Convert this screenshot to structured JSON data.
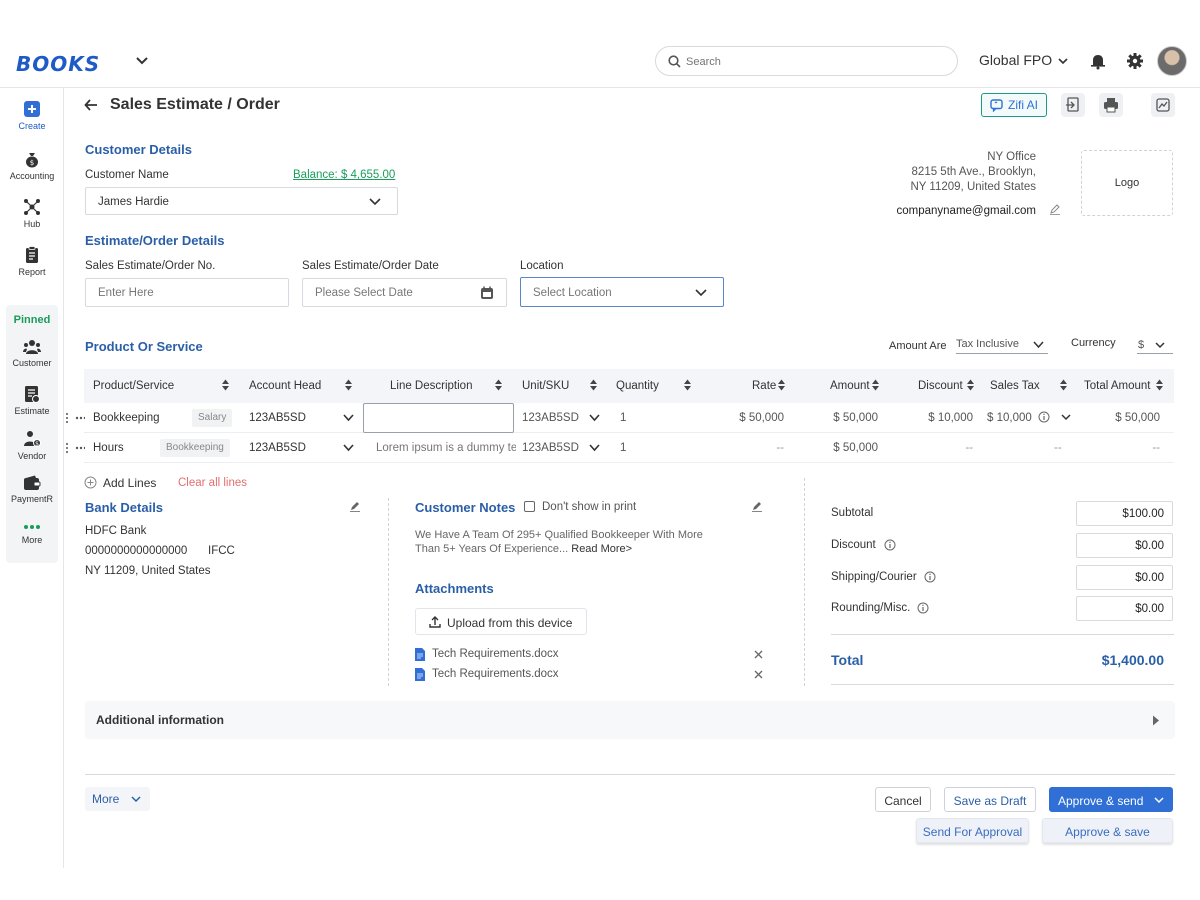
{
  "app": {
    "logo": "BOOKS",
    "organization": "Global FPO",
    "search_placeholder": "Search"
  },
  "sidebar": {
    "items": [
      {
        "label": "Create",
        "icon": "create-icon"
      },
      {
        "label": "Accounting",
        "icon": "moneybag-icon"
      },
      {
        "label": "Hub",
        "icon": "hub-icon"
      },
      {
        "label": "Report",
        "icon": "report-icon"
      }
    ],
    "pinned_label": "Pinned",
    "pinned": [
      {
        "label": "Customer",
        "icon": "customers-icon"
      },
      {
        "label": "Estimate",
        "icon": "estimate-icon"
      },
      {
        "label": "Vendor",
        "icon": "vendor-icon"
      },
      {
        "label": "PaymentR",
        "icon": "wallet-icon"
      },
      {
        "label": "More",
        "icon": "more-dots-icon"
      }
    ]
  },
  "page": {
    "title": "Sales Estimate / Order",
    "zifi_label": "Zifi AI"
  },
  "customer": {
    "section_title": "Customer Details",
    "name_label": "Customer Name",
    "balance": "Balance: $ 4,655.00",
    "name_value": "James Hardie",
    "company_address": [
      "NY Office",
      "8215 5th Ave., Brooklyn,",
      "NY 11209, United States"
    ],
    "company_email": "companyname@gmail.com",
    "logo_placeholder": "Logo"
  },
  "estimate": {
    "section_title": "Estimate/Order Details",
    "number_label": "Sales Estimate/Order No.",
    "number_placeholder": "Enter Here",
    "date_label": "Sales Estimate/Order Date",
    "date_placeholder": "Please Select Date",
    "location_label": "Location",
    "location_placeholder": "Select Location"
  },
  "products": {
    "section_title": "Product Or Service",
    "amount_are_label": "Amount Are",
    "amount_are_value": "Tax Inclusive",
    "currency_label": "Currency",
    "currency_value": "$",
    "columns": [
      "Product/Service",
      "Account Head",
      "Line Description",
      "Unit/SKU",
      "Quantity",
      "Rate",
      "Amount",
      "Discount",
      "Sales Tax",
      "Total Amount"
    ],
    "rows": [
      {
        "product": "Bookkeeping",
        "tag": "Salary",
        "account": "123AB5SD",
        "description": "",
        "unit": "123AB5SD",
        "qty": "1",
        "rate": "$ 50,000",
        "amount": "$ 50,000",
        "discount": "$ 10,000",
        "tax": "$ 10,000",
        "total": "$ 50,000"
      },
      {
        "product": "Hours",
        "tag": "Bookkeeping",
        "account": "123AB5SD",
        "description": "Lorem ipsum is a dummy te",
        "unit": "123AB5SD",
        "qty": "1",
        "rate": "--",
        "amount": "$ 50,000",
        "discount": "--",
        "tax": "--",
        "total": "--"
      }
    ],
    "add_lines": "Add Lines",
    "clear_lines": "Clear all lines"
  },
  "bank": {
    "title": "Bank Details",
    "bank_name": "HDFC Bank",
    "account": "0000000000000000",
    "ifsc": "IFCC",
    "address": "NY 11209, United States"
  },
  "notes": {
    "title": "Customer Notes",
    "dont_show": "Don't show in print",
    "text_line1": "We Have A Team Of 295+ Qualified Bookkeeper With More",
    "text_line2": "Than 5+ Years Of Experience...",
    "read_more": "Read More>"
  },
  "attachments": {
    "title": "Attachments",
    "upload_label": "Upload from this device",
    "files": [
      "Tech Requirements.docx",
      "Tech Requirements.docx"
    ]
  },
  "totals": {
    "subtotal_label": "Subtotal",
    "subtotal": "$100.00",
    "discount_label": "Discount",
    "discount": "$0.00",
    "shipping_label": "Shipping/Courier",
    "shipping": "$0.00",
    "rounding_label": "Rounding/Misc.",
    "rounding": "$0.00",
    "total_label": "Total",
    "total": "$1,400.00"
  },
  "additional_info": "Additional information",
  "footer": {
    "more": "More",
    "cancel": "Cancel",
    "save_draft": "Save as Draft",
    "approve_send": "Approve & send",
    "send_approval": "Send For Approval",
    "approve_save": "Approve & save"
  },
  "colors": {
    "accent": "#2f6fd6",
    "section_title": "#2a5fa8",
    "balance": "#1a9c5b",
    "clear": "#e07070"
  }
}
